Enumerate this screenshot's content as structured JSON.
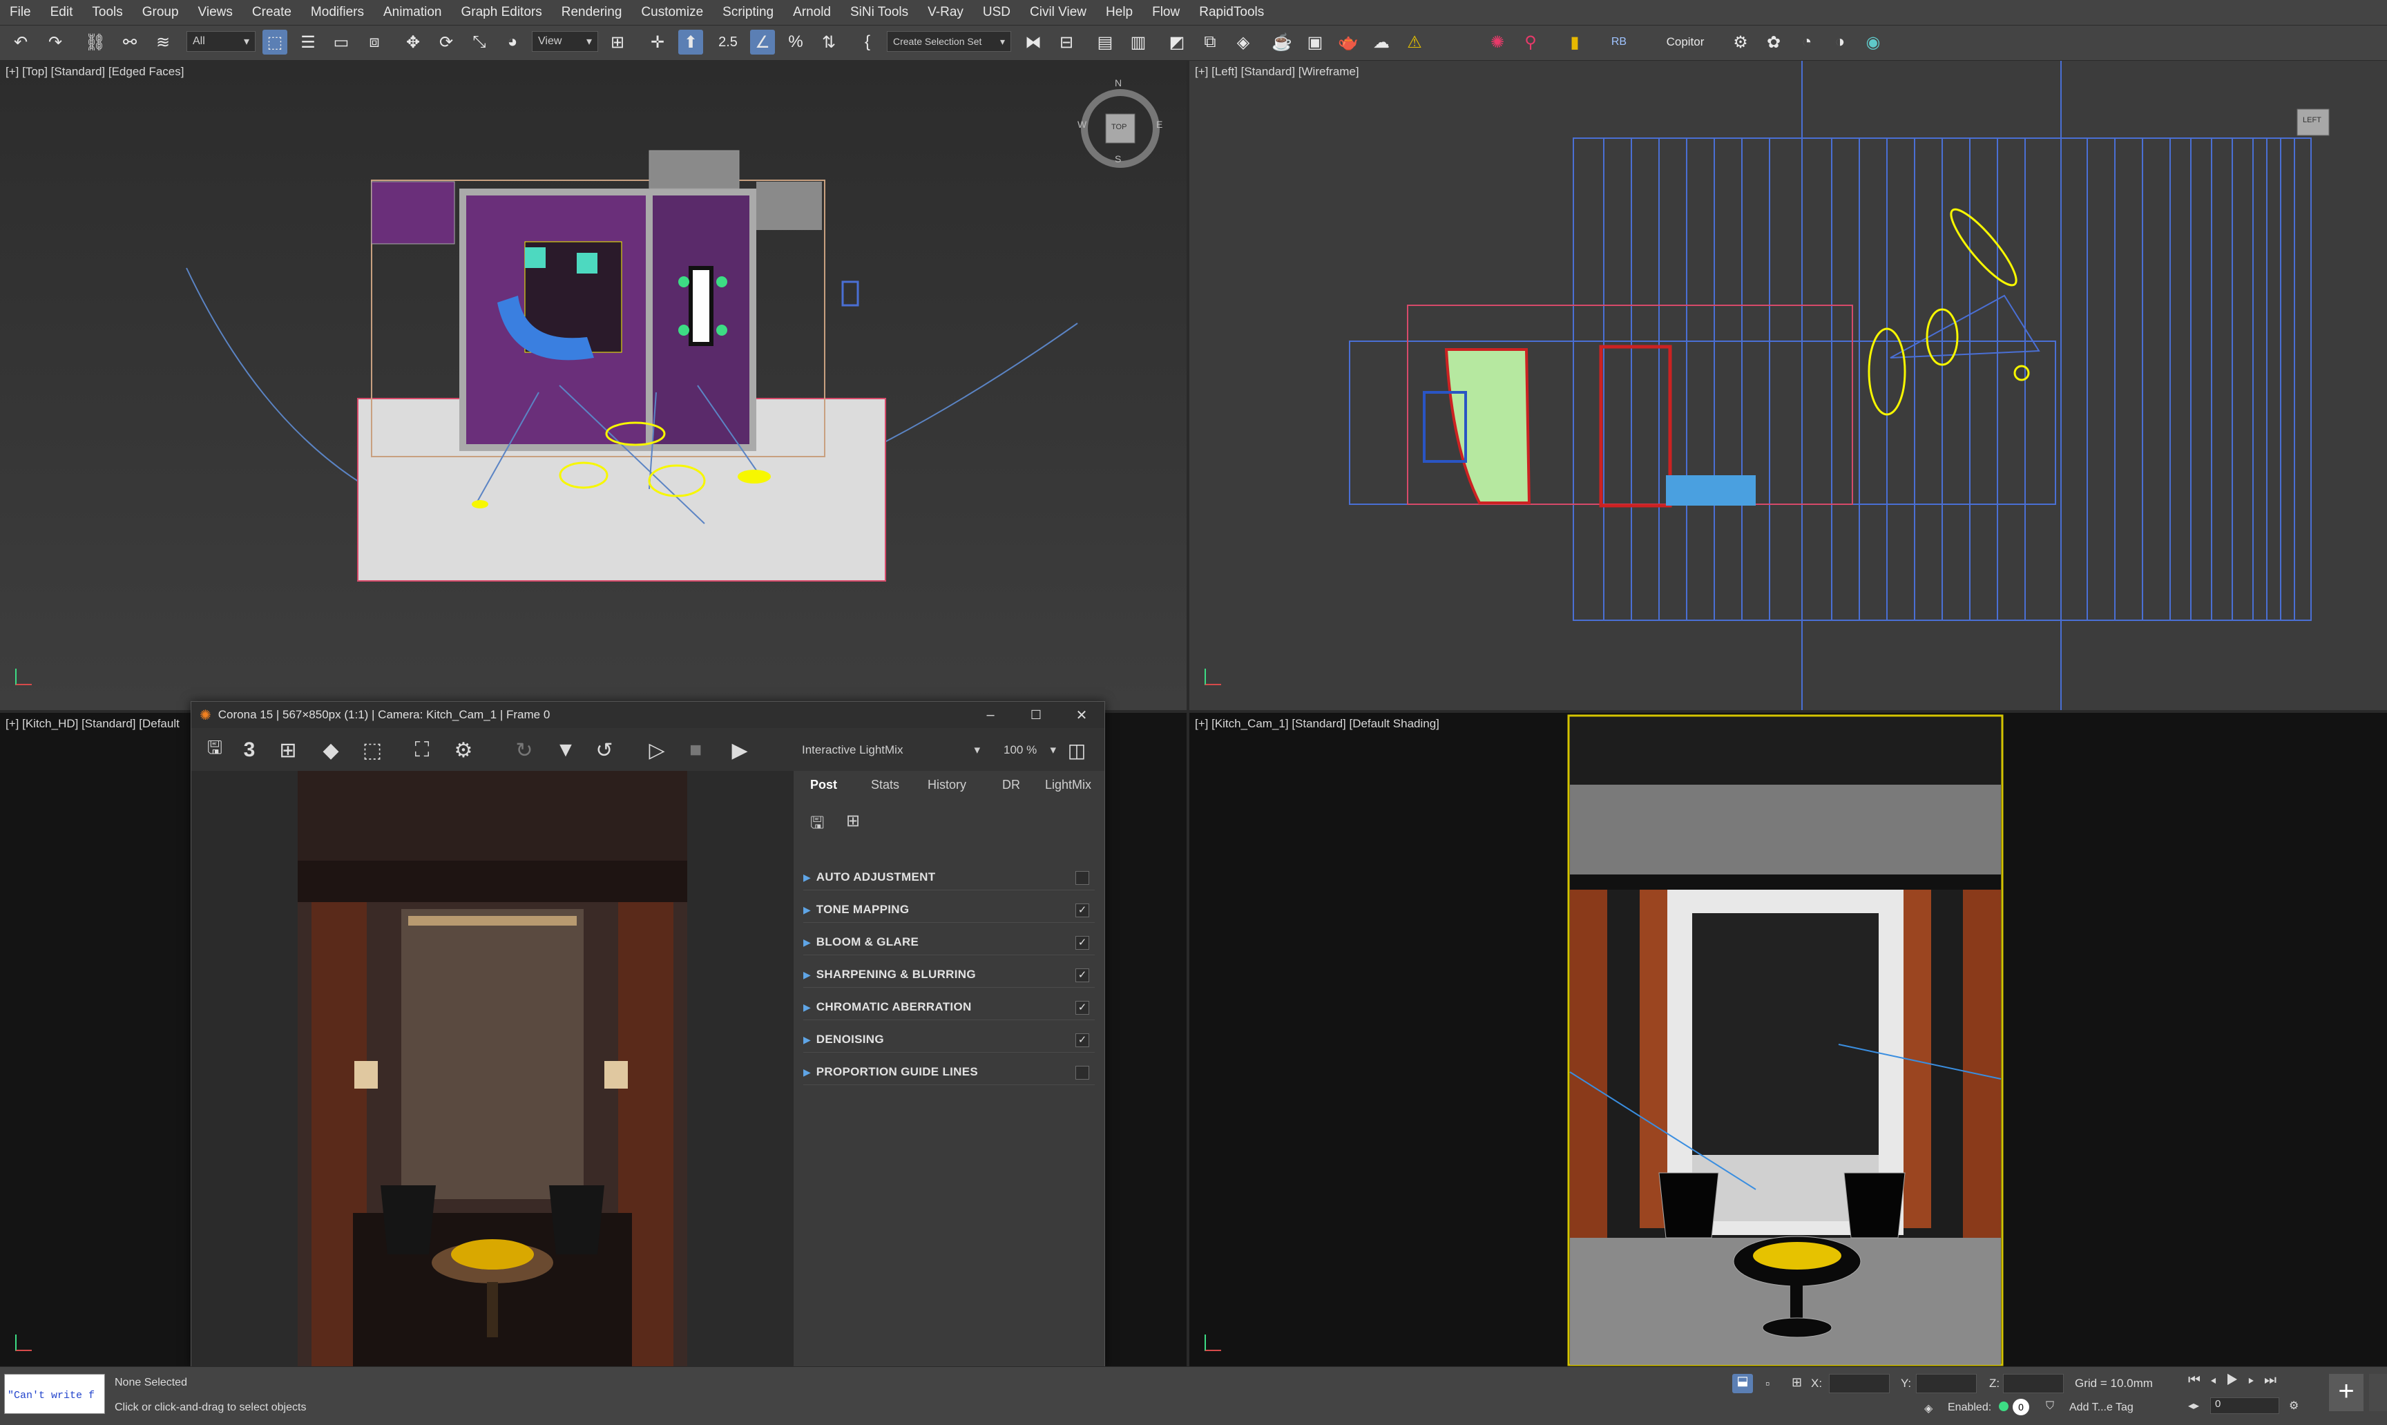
{
  "menu": [
    "File",
    "Edit",
    "Tools",
    "Group",
    "Views",
    "Create",
    "Modifiers",
    "Animation",
    "Graph Editors",
    "Rendering",
    "Customize",
    "Scripting",
    "Arnold",
    "SiNi Tools",
    "V-Ray",
    "USD",
    "Civil View",
    "Help",
    "Flow",
    "RapidTools"
  ],
  "toolbar": {
    "filter_value": "All",
    "view_value": "View",
    "selection_set_value": "Create Selection Set",
    "copitor_label": "Copitor",
    "snap_label": "2.5"
  },
  "viewports": {
    "top": {
      "label": "[+] [Top] [Standard] [Edged Faces]",
      "compass": {
        "n": "N",
        "s": "S",
        "e": "E",
        "w": "W",
        "cube": "TOP"
      }
    },
    "left": {
      "label": "[+] [Left] [Standard] [Wireframe]",
      "cube": "LEFT"
    },
    "kitch_hd": {
      "label": "[+] [Kitch_HD] [Standard] [Default"
    },
    "kitch_cam": {
      "label": "[+] [Kitch_Cam_1] [Standard] [Default Shading]"
    }
  },
  "corona": {
    "title": "Corona 15 | 567×850px (1:1) | Camera: Kitch_Cam_1 | Frame 0",
    "toolbar": {
      "passes_label": "3",
      "mode_value": "Interactive LightMix",
      "zoom_value": "100 %"
    },
    "tabs": [
      "Post",
      "Stats",
      "History",
      "DR",
      "LightMix"
    ],
    "sections": [
      {
        "label": "AUTO ADJUSTMENT",
        "checked": false
      },
      {
        "label": "TONE MAPPING",
        "checked": true
      },
      {
        "label": "BLOOM & GLARE",
        "checked": true
      },
      {
        "label": "SHARPENING & BLURRING",
        "checked": true
      },
      {
        "label": "CHROMATIC ABERRATION",
        "checked": true
      },
      {
        "label": "DENOISING",
        "checked": true
      },
      {
        "label": "PROPORTION GUIDE LINES",
        "checked": false
      }
    ],
    "checkmark": "✓"
  },
  "status": {
    "script_error": "\"Can't write f",
    "selection": "None Selected",
    "hint": "Click or click-and-drag to select objects",
    "x_label": "X:",
    "y_label": "Y:",
    "z_label": "Z:",
    "grid": "Grid = 10.0mm",
    "enabled_label": "Enabled:",
    "enabled_value": "0",
    "time_tag": "Add T...e Tag",
    "frame_value": "0"
  },
  "colors": {
    "accent": "#5b7fb4",
    "viewport_active_border": "#d4c400",
    "light": "#f7f700",
    "wire": "#4a6fd4"
  }
}
